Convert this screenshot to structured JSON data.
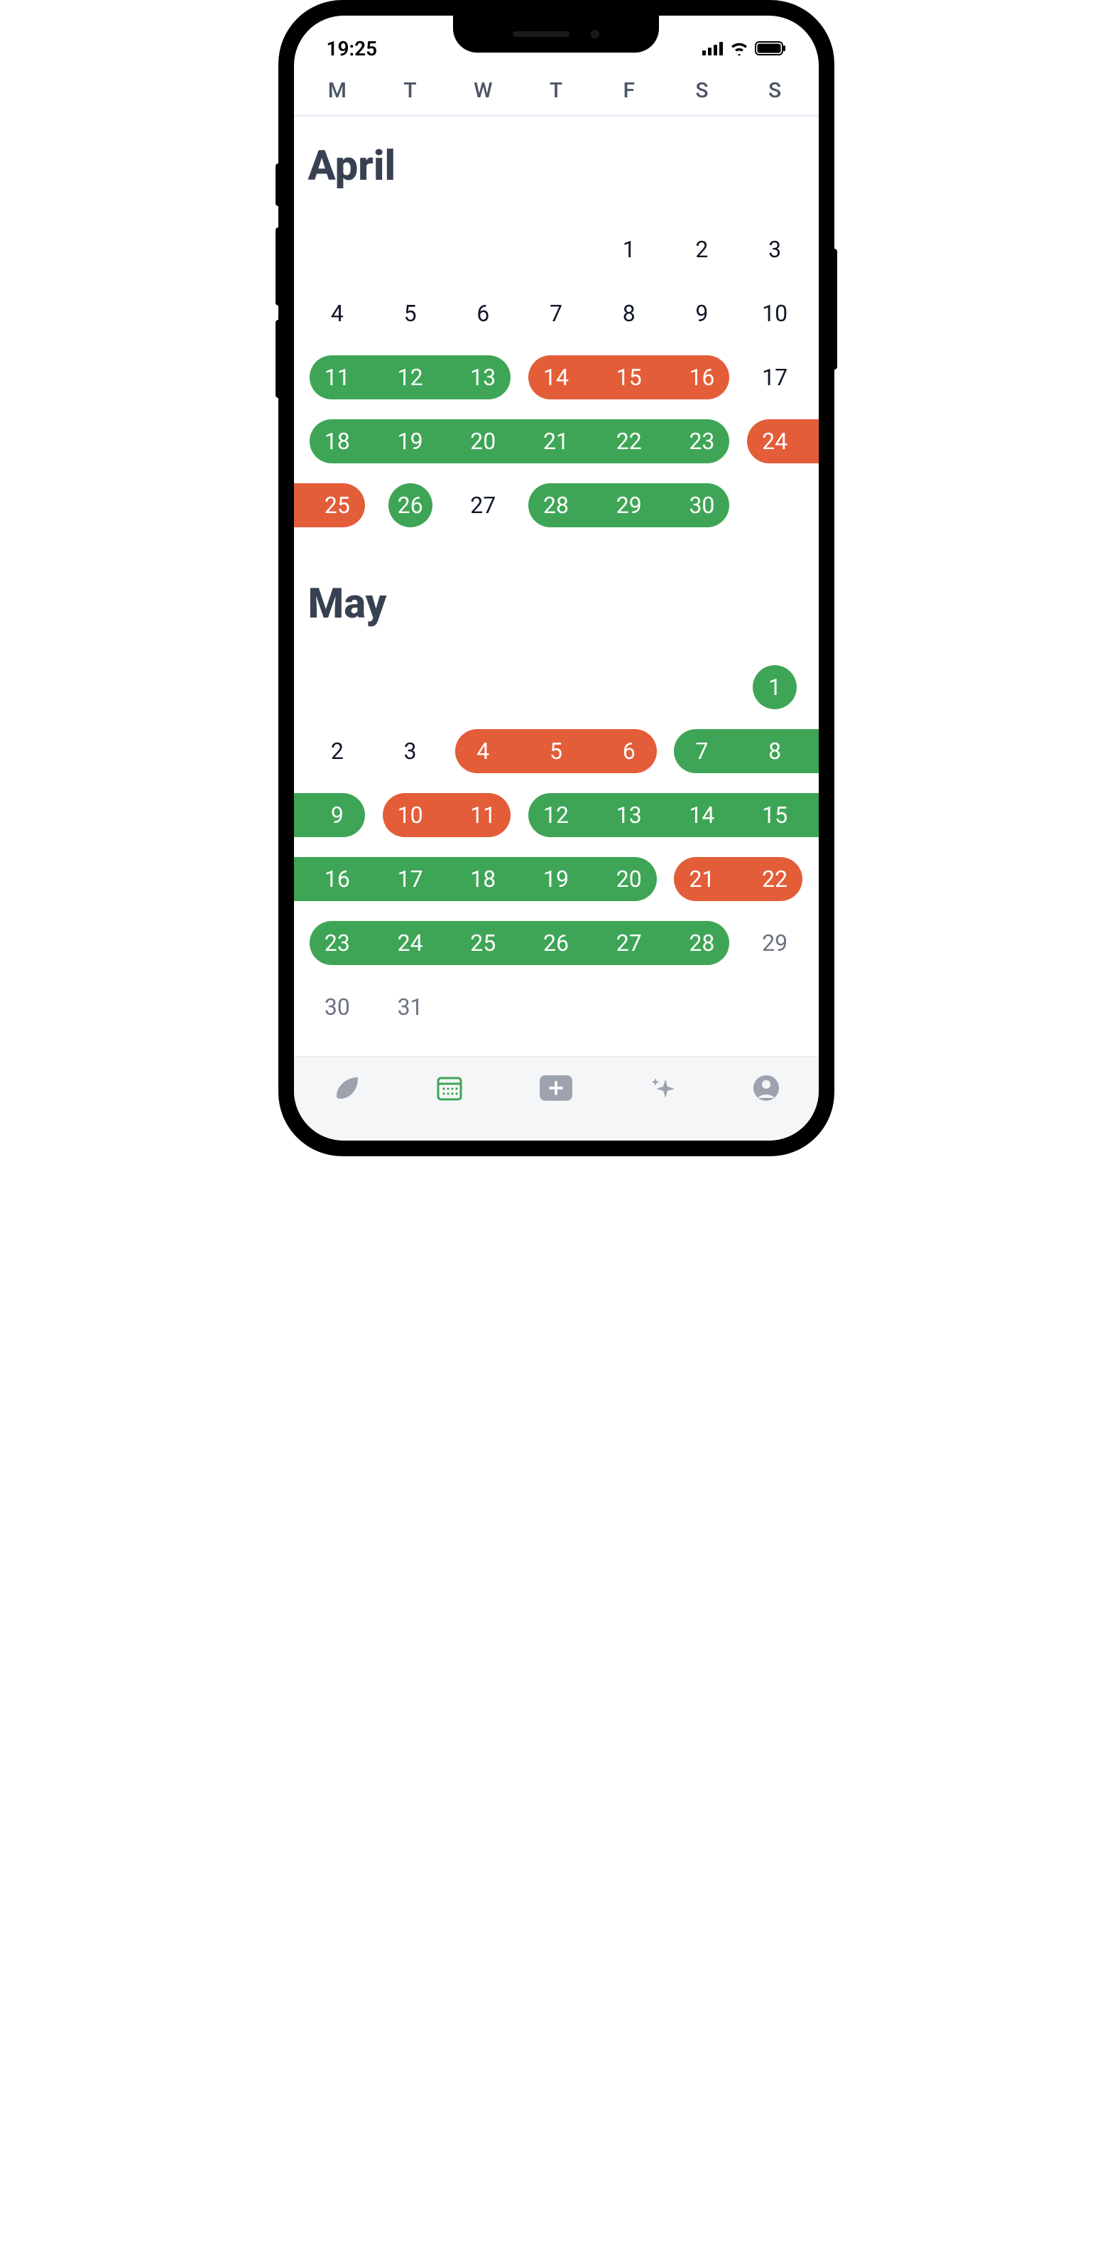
{
  "status": {
    "time": "19:25"
  },
  "weekdays": [
    "M",
    "T",
    "W",
    "T",
    "F",
    "S",
    "S"
  ],
  "colors": {
    "green": "#3fa556",
    "red": "#e35d39",
    "text": "#374151",
    "future": "#6b7280"
  },
  "months": [
    {
      "name": "April",
      "start_weekday_index": 4,
      "weeks": [
        [
          {
            "d": "",
            "s": "empty"
          },
          {
            "d": "",
            "s": "empty"
          },
          {
            "d": "",
            "s": "empty"
          },
          {
            "d": "",
            "s": "empty"
          },
          {
            "d": "1",
            "s": "none"
          },
          {
            "d": "2",
            "s": "none"
          },
          {
            "d": "3",
            "s": "none"
          }
        ],
        [
          {
            "d": "4",
            "s": "none"
          },
          {
            "d": "5",
            "s": "none"
          },
          {
            "d": "6",
            "s": "none"
          },
          {
            "d": "7",
            "s": "none"
          },
          {
            "d": "8",
            "s": "none"
          },
          {
            "d": "9",
            "s": "none"
          },
          {
            "d": "10",
            "s": "none"
          }
        ],
        [
          {
            "d": "11",
            "s": "green",
            "pill": "start"
          },
          {
            "d": "12",
            "s": "green",
            "pill": "mid"
          },
          {
            "d": "13",
            "s": "green",
            "pill": "end"
          },
          {
            "d": "14",
            "s": "red",
            "pill": "start"
          },
          {
            "d": "15",
            "s": "red",
            "pill": "mid"
          },
          {
            "d": "16",
            "s": "red",
            "pill": "end"
          },
          {
            "d": "17",
            "s": "none"
          }
        ],
        [
          {
            "d": "18",
            "s": "green",
            "pill": "start"
          },
          {
            "d": "19",
            "s": "green",
            "pill": "mid"
          },
          {
            "d": "20",
            "s": "green",
            "pill": "mid"
          },
          {
            "d": "21",
            "s": "green",
            "pill": "mid"
          },
          {
            "d": "22",
            "s": "green",
            "pill": "mid"
          },
          {
            "d": "23",
            "s": "green",
            "pill": "end"
          },
          {
            "d": "24",
            "s": "red",
            "pill": "edge-right"
          }
        ],
        [
          {
            "d": "25",
            "s": "red",
            "pill": "edge-left"
          },
          {
            "d": "26",
            "s": "green",
            "pill": "circle"
          },
          {
            "d": "27",
            "s": "none"
          },
          {
            "d": "28",
            "s": "green",
            "pill": "start"
          },
          {
            "d": "29",
            "s": "green",
            "pill": "mid"
          },
          {
            "d": "30",
            "s": "green",
            "pill": "end"
          },
          {
            "d": "",
            "s": "empty"
          }
        ]
      ]
    },
    {
      "name": "May",
      "start_weekday_index": 6,
      "weeks": [
        [
          {
            "d": "",
            "s": "empty"
          },
          {
            "d": "",
            "s": "empty"
          },
          {
            "d": "",
            "s": "empty"
          },
          {
            "d": "",
            "s": "empty"
          },
          {
            "d": "",
            "s": "empty"
          },
          {
            "d": "",
            "s": "empty"
          },
          {
            "d": "1",
            "s": "green",
            "pill": "circle"
          }
        ],
        [
          {
            "d": "2",
            "s": "none"
          },
          {
            "d": "3",
            "s": "none"
          },
          {
            "d": "4",
            "s": "red",
            "pill": "start"
          },
          {
            "d": "5",
            "s": "red",
            "pill": "mid"
          },
          {
            "d": "6",
            "s": "red",
            "pill": "end"
          },
          {
            "d": "7",
            "s": "green",
            "pill": "start"
          },
          {
            "d": "8",
            "s": "green",
            "pill": "edge-right-flat"
          }
        ],
        [
          {
            "d": "9",
            "s": "green",
            "pill": "edge-left-flat-end"
          },
          {
            "d": "10",
            "s": "red",
            "pill": "start"
          },
          {
            "d": "11",
            "s": "red",
            "pill": "end"
          },
          {
            "d": "12",
            "s": "green",
            "pill": "start"
          },
          {
            "d": "13",
            "s": "green",
            "pill": "mid"
          },
          {
            "d": "14",
            "s": "green",
            "pill": "mid"
          },
          {
            "d": "15",
            "s": "green",
            "pill": "edge-right-flat"
          }
        ],
        [
          {
            "d": "16",
            "s": "green",
            "pill": "edge-left-flat"
          },
          {
            "d": "17",
            "s": "green",
            "pill": "mid"
          },
          {
            "d": "18",
            "s": "green",
            "pill": "mid"
          },
          {
            "d": "19",
            "s": "green",
            "pill": "mid"
          },
          {
            "d": "20",
            "s": "green",
            "pill": "end"
          },
          {
            "d": "21",
            "s": "red",
            "pill": "start"
          },
          {
            "d": "22",
            "s": "red",
            "pill": "end"
          }
        ],
        [
          {
            "d": "23",
            "s": "green",
            "pill": "start"
          },
          {
            "d": "24",
            "s": "green",
            "pill": "mid"
          },
          {
            "d": "25",
            "s": "green",
            "pill": "mid"
          },
          {
            "d": "26",
            "s": "green",
            "pill": "mid"
          },
          {
            "d": "27",
            "s": "green",
            "pill": "mid"
          },
          {
            "d": "28",
            "s": "green",
            "pill": "end"
          },
          {
            "d": "29",
            "s": "future"
          }
        ],
        [
          {
            "d": "30",
            "s": "future"
          },
          {
            "d": "31",
            "s": "future"
          },
          {
            "d": "",
            "s": "empty"
          },
          {
            "d": "",
            "s": "empty"
          },
          {
            "d": "",
            "s": "empty"
          },
          {
            "d": "",
            "s": "empty"
          },
          {
            "d": "",
            "s": "empty"
          }
        ]
      ]
    }
  ],
  "tabs": [
    {
      "icon": "leaf-icon",
      "active": false
    },
    {
      "icon": "calendar-icon",
      "active": true
    },
    {
      "icon": "add-icon",
      "active": false
    },
    {
      "icon": "sparkle-icon",
      "active": false
    },
    {
      "icon": "profile-icon",
      "active": false
    }
  ]
}
